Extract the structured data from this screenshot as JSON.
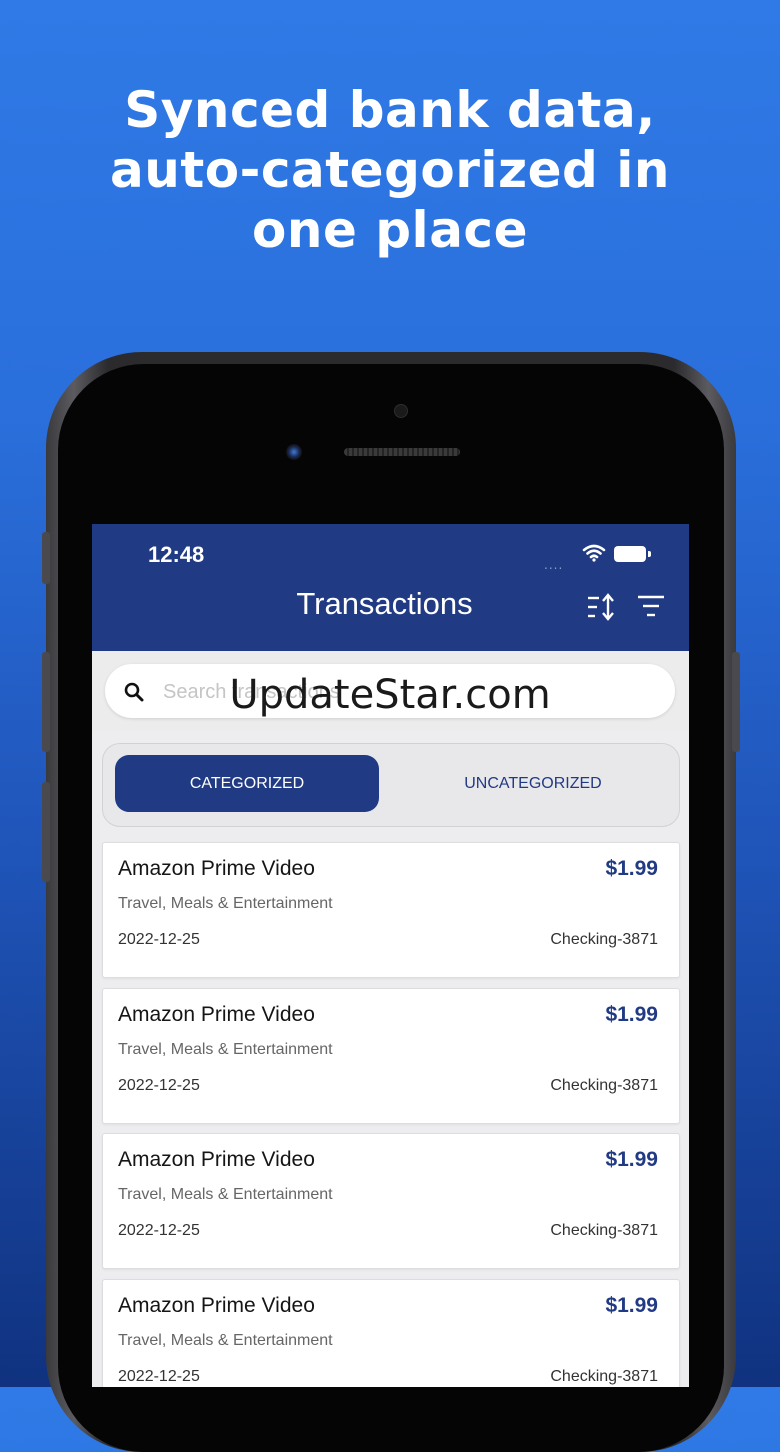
{
  "headline": {
    "line1": "Synced bank data,",
    "line2": "auto-categorized in",
    "line3": "one place"
  },
  "status_bar": {
    "time": "12:48",
    "signal": "....",
    "icons": [
      "wifi-icon",
      "battery-icon"
    ]
  },
  "header": {
    "title": "Transactions",
    "icons": [
      "sort-icon",
      "filter-icon"
    ]
  },
  "search": {
    "placeholder": "Search transactions",
    "value": ""
  },
  "tabs": [
    {
      "label": "CATEGORIZED",
      "selected": true
    },
    {
      "label": "UNCATEGORIZED",
      "selected": false
    }
  ],
  "transactions": [
    {
      "name": "Amazon Prime Video",
      "amount": "$1.99",
      "category": "Travel, Meals & Entertainment",
      "date": "2022-12-25",
      "account": "Checking-3871"
    },
    {
      "name": "Amazon Prime Video",
      "amount": "$1.99",
      "category": "Travel, Meals & Entertainment",
      "date": "2022-12-25",
      "account": "Checking-3871"
    },
    {
      "name": "Amazon Prime Video",
      "amount": "$1.99",
      "category": "Travel, Meals & Entertainment",
      "date": "2022-12-25",
      "account": "Checking-3871"
    },
    {
      "name": "Amazon Prime Video",
      "amount": "$1.99",
      "category": "Travel, Meals & Entertainment",
      "date": "2022-12-25",
      "account": "Checking-3871"
    }
  ],
  "watermark": "UpdateStar.com",
  "colors": {
    "accent": "#213a84",
    "background_top": "#2f7ae6",
    "background_bottom": "#10327f"
  }
}
